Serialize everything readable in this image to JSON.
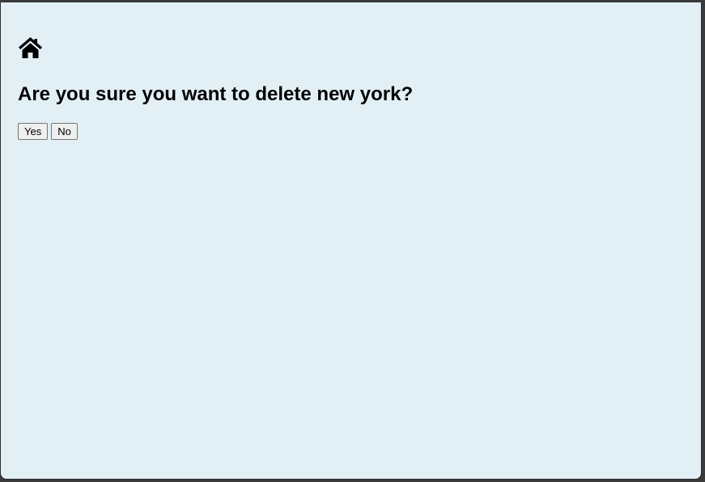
{
  "page": {
    "home_icon": "home-icon",
    "question": "Are you sure you want to delete new york?"
  },
  "actions": {
    "yes_label": "Yes",
    "no_label": "No"
  },
  "colors": {
    "background": "#e2f0f6",
    "text": "#000000"
  }
}
